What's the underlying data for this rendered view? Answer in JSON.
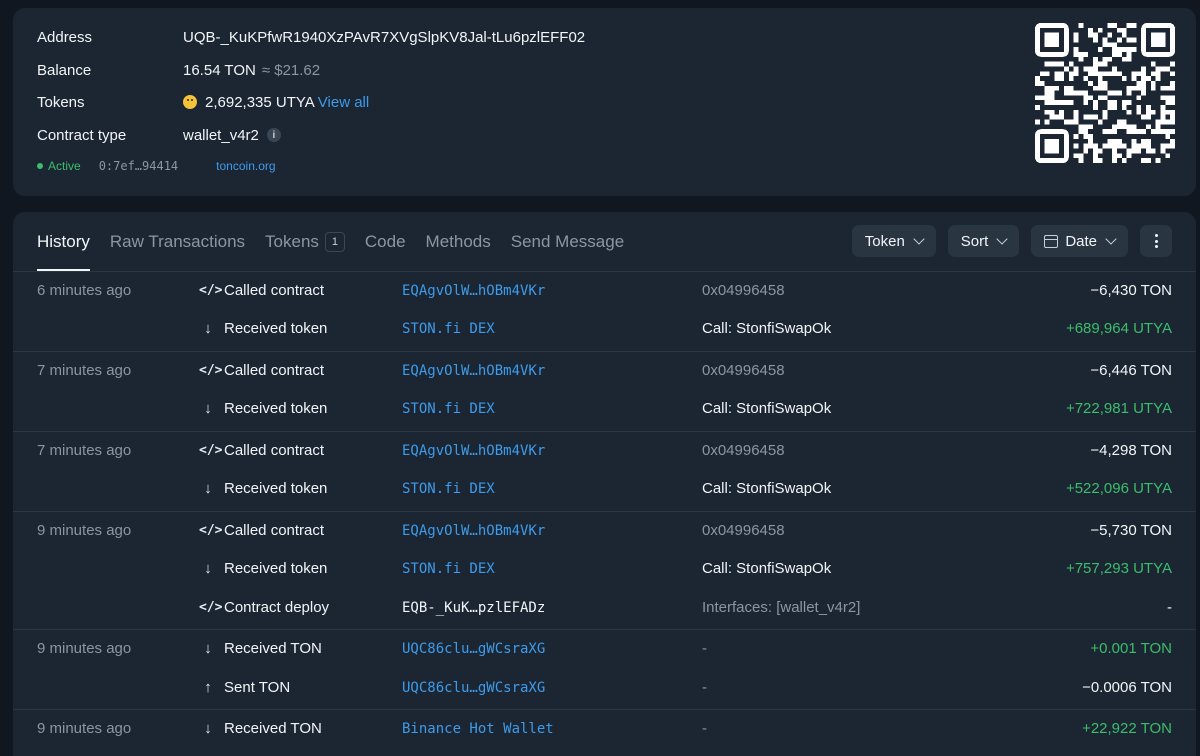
{
  "info": {
    "address_label": "Address",
    "address_value": "UQB-_KuKPfwR1940XzPAvR7XVgSlpKV8Jal-tLu6pzlEFF02",
    "balance_label": "Balance",
    "balance_value": "16.54 TON",
    "balance_fiat": "≈ $21.62",
    "tokens_label": "Tokens",
    "tokens_value": "2,692,335 UTYA",
    "tokens_link": "View all",
    "contract_type_label": "Contract type",
    "contract_type_value": "wallet_v4r2",
    "info_badge": "i",
    "status": "Active",
    "hash": "0:7ef…94414",
    "site": "toncoin.org"
  },
  "tabs": [
    {
      "label": "History",
      "active": true
    },
    {
      "label": "Raw Transactions"
    },
    {
      "label": "Tokens",
      "count": "1"
    },
    {
      "label": "Code"
    },
    {
      "label": "Methods"
    },
    {
      "label": "Send Message"
    }
  ],
  "filters": {
    "token": "Token",
    "sort": "Sort",
    "date": "Date"
  },
  "transactions": [
    {
      "time": "6 minutes ago",
      "icon": "code-icon",
      "action": "Called contract",
      "party": "EQAgvOlW…hOBm4VKr",
      "meta": "0x04996458",
      "amount": "−6,430 TON",
      "positive": false
    },
    {
      "time": "",
      "icon": "arrow-down-icon",
      "action": "Received token",
      "party": "STON.fi DEX",
      "meta": "Call: StonfiSwapOk",
      "amount": "+689,964 UTYA",
      "positive": true
    },
    {
      "time": "7 minutes ago",
      "icon": "code-icon",
      "action": "Called contract",
      "party": "EQAgvOlW…hOBm4VKr",
      "meta": "0x04996458",
      "amount": "−6,446 TON",
      "positive": false
    },
    {
      "time": "",
      "icon": "arrow-down-icon",
      "action": "Received token",
      "party": "STON.fi DEX",
      "meta": "Call: StonfiSwapOk",
      "amount": "+722,981 UTYA",
      "positive": true
    },
    {
      "time": "7 minutes ago",
      "icon": "code-icon",
      "action": "Called contract",
      "party": "EQAgvOlW…hOBm4VKr",
      "meta": "0x04996458",
      "amount": "−4,298 TON",
      "positive": false
    },
    {
      "time": "",
      "icon": "arrow-down-icon",
      "action": "Received token",
      "party": "STON.fi DEX",
      "meta": "Call: StonfiSwapOk",
      "amount": "+522,096 UTYA",
      "positive": true
    },
    {
      "time": "9 minutes ago",
      "icon": "code-icon",
      "action": "Called contract",
      "party": "EQAgvOlW…hOBm4VKr",
      "meta": "0x04996458",
      "amount": "−5,730 TON",
      "positive": false
    },
    {
      "time": "",
      "icon": "arrow-down-icon",
      "action": "Received token",
      "party": "STON.fi DEX",
      "meta": "Call: StonfiSwapOk",
      "amount": "+757,293 UTYA",
      "positive": true
    },
    {
      "time": "",
      "icon": "code-icon",
      "action": "Contract deploy",
      "party": "EQB-_KuK…pzlEFADz",
      "meta": "Interfaces: [wallet_v4r2]",
      "amount": "-",
      "positive": false
    },
    {
      "time": "9 minutes ago",
      "icon": "arrow-down-icon",
      "action": "Received TON",
      "party": "UQC86clu…gWCsraXG",
      "meta": "-",
      "amount": "+0.001 TON",
      "positive": true
    },
    {
      "time": "",
      "icon": "arrow-up-icon",
      "action": "Sent TON",
      "party": "UQC86clu…gWCsraXG",
      "meta": "-",
      "amount": "−0.0006 TON",
      "positive": false
    },
    {
      "time": "9 minutes ago",
      "icon": "arrow-down-icon",
      "action": "Received TON",
      "party": "Binance Hot Wallet",
      "meta": "-",
      "amount": "+22,922 TON",
      "positive": true
    }
  ]
}
